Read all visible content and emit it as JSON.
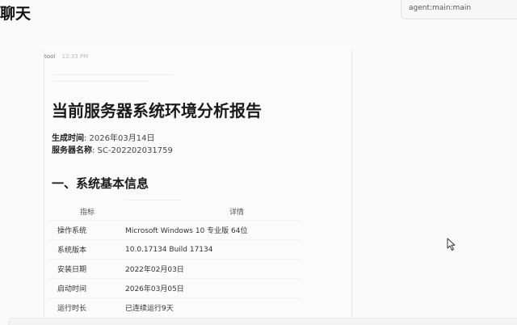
{
  "header": {
    "title": "聊天",
    "session": "agent:main:main"
  },
  "message": {
    "sender": "tool",
    "time": "12:33 PM"
  },
  "report": {
    "title": "当前服务器系统环境分析报告",
    "generated_label": "生成时间",
    "generated_value": ": 2026年03月14日",
    "server_label": "服务器名称",
    "server_value": ": SC-202202031759",
    "section_title": "一、系统基本信息",
    "table": {
      "headers": [
        "指标",
        "详情"
      ],
      "rows": [
        {
          "label": "操作系统",
          "value": "Microsoft Windows 10 专业版 64位"
        },
        {
          "label": "系统版本",
          "value": "10.0.17134 Build 17134"
        },
        {
          "label": "安装日期",
          "value": "2022年02月03日"
        },
        {
          "label": "启动时间",
          "value": "2026年03月05日"
        },
        {
          "label": "运行时长",
          "value": "已连续运行9天"
        }
      ]
    }
  }
}
